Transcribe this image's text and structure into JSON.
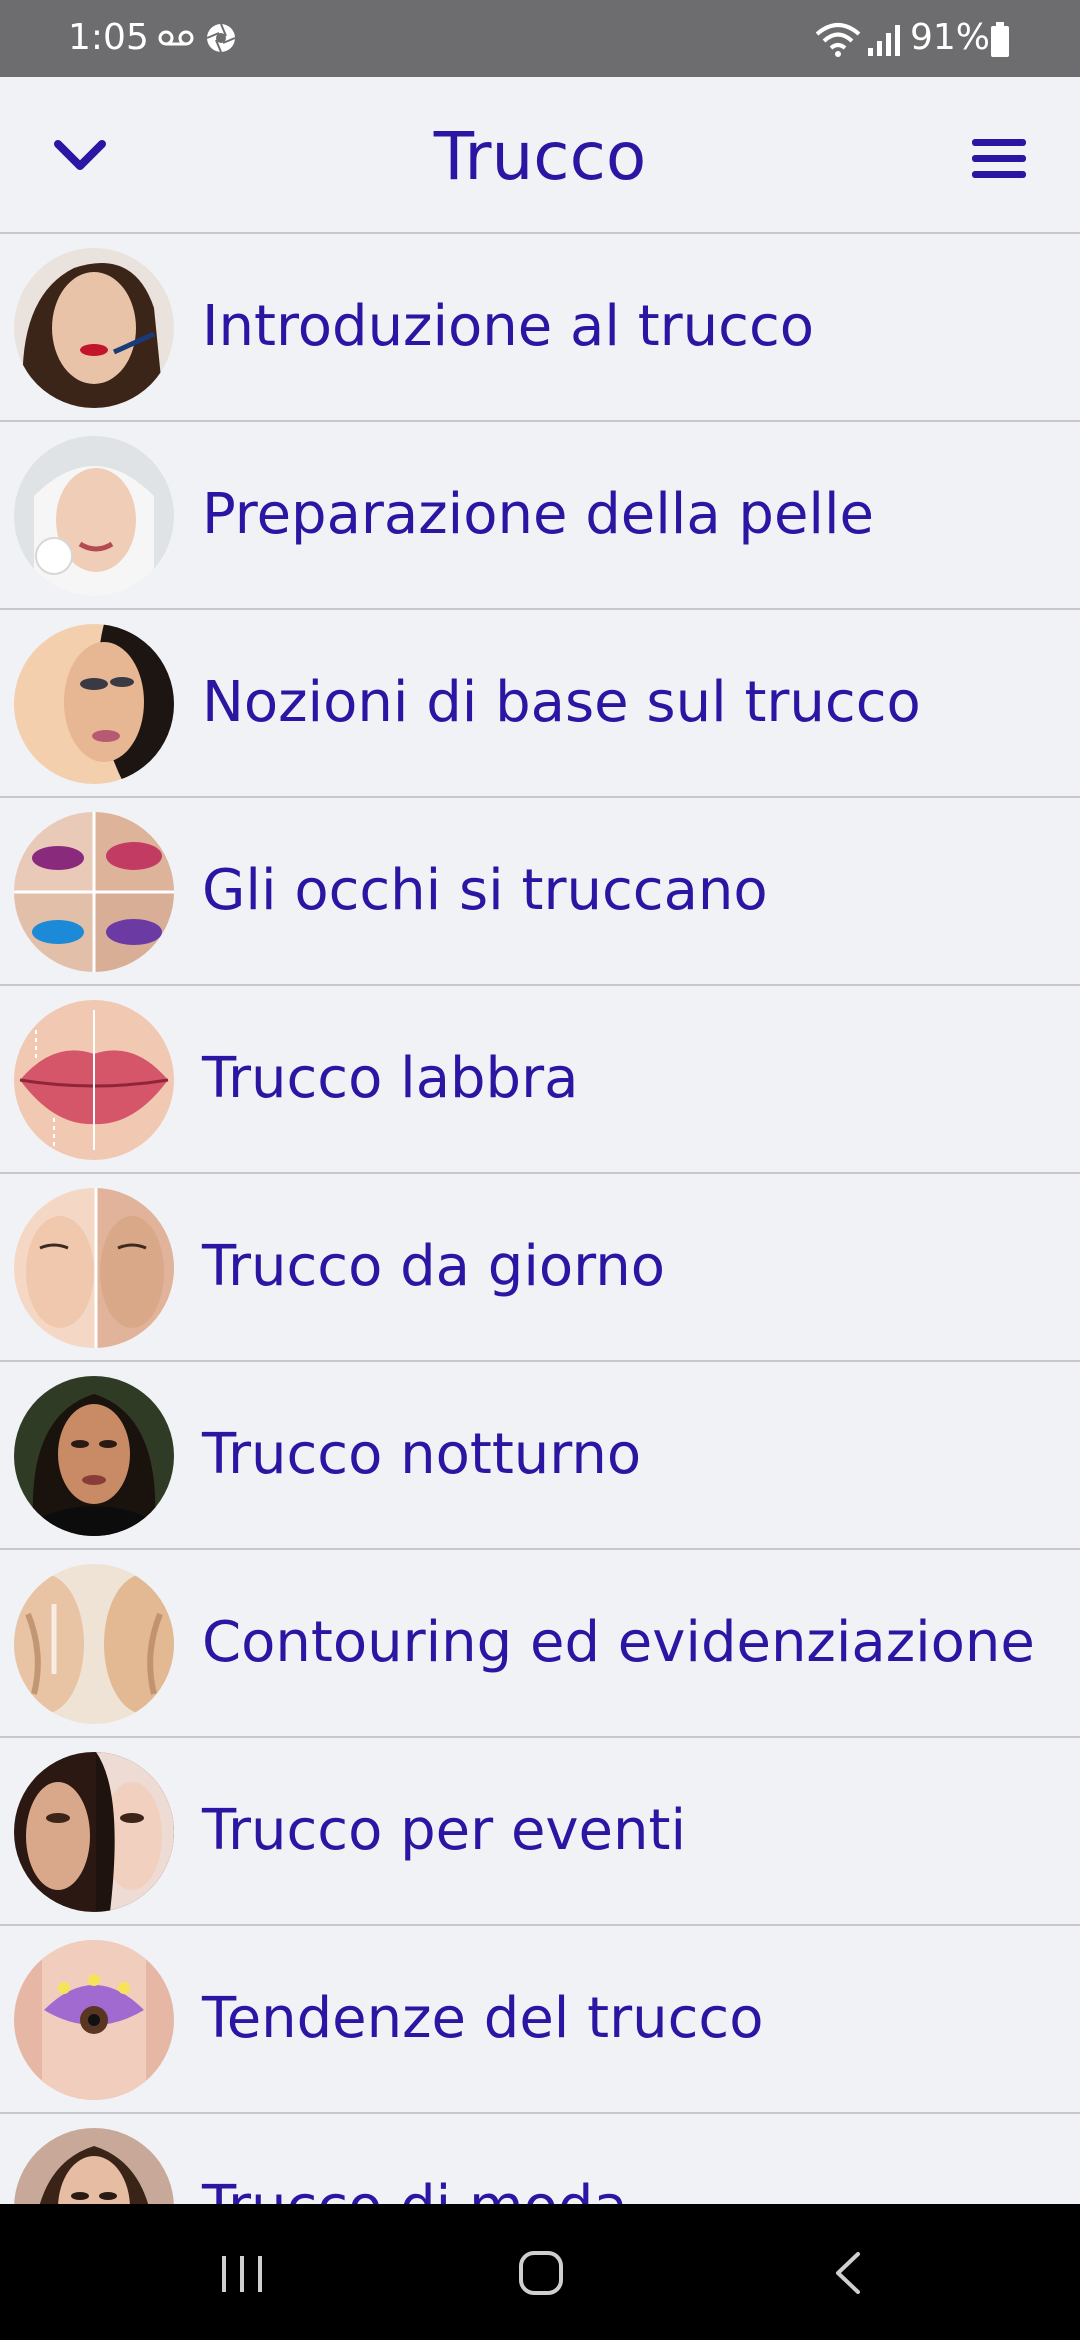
{
  "status_bar": {
    "time": "1:05",
    "battery_percent": "91%",
    "icons": [
      "voicemail-icon",
      "aperture-icon",
      "wifi-icon",
      "signal-icon",
      "battery-icon"
    ]
  },
  "header": {
    "title": "Trucco",
    "left_icon": "chevron-down-icon",
    "right_icon": "hamburger-menu-icon"
  },
  "colors": {
    "accent": "#2a16a3",
    "background": "#f1f2f6",
    "divider": "#c8c8cc",
    "status_bar": "#6d6d6f",
    "nav_bar": "#000000"
  },
  "list": {
    "items": [
      {
        "label": "Introduzione al trucco"
      },
      {
        "label": "Preparazione della pelle"
      },
      {
        "label": "Nozioni di base sul trucco"
      },
      {
        "label": "Gli occhi si truccano"
      },
      {
        "label": "Trucco labbra"
      },
      {
        "label": "Trucco da giorno"
      },
      {
        "label": "Trucco notturno"
      },
      {
        "label": "Contouring ed evidenziazione"
      },
      {
        "label": "Trucco per eventi"
      },
      {
        "label": "Tendenze del trucco"
      },
      {
        "label": "Trucco di moda"
      }
    ]
  },
  "nav_bar": {
    "icons": [
      "recents-icon",
      "home-icon",
      "back-icon"
    ]
  }
}
